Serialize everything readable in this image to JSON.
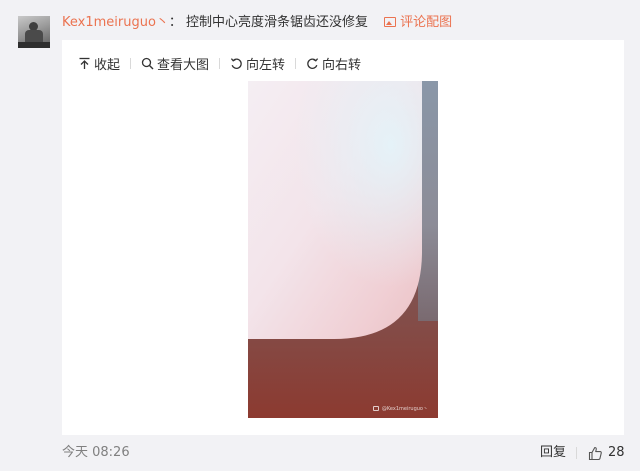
{
  "comment": {
    "username": "Kex1meiruguo丶",
    "separator": "：",
    "text": "控制中心亮度滑条锯齿还没修复",
    "image_link_label": "评论配图"
  },
  "media_toolbar": {
    "collapse_label": "收起",
    "view_large_label": "查看大图",
    "rotate_left_label": "向左转",
    "rotate_right_label": "向右转"
  },
  "photo": {
    "watermark_text": "@Kex1meiruguo丶"
  },
  "footer": {
    "timestamp": "今天 08:26",
    "reply_label": "回复",
    "like_count": "28"
  },
  "colors": {
    "accent": "#eb7350",
    "text": "#333333",
    "muted": "#808080",
    "background": "#f2f2f5"
  },
  "icons": [
    "avatar",
    "image-icon",
    "collapse-icon",
    "search-icon",
    "rotate-left-icon",
    "rotate-right-icon",
    "thumbs-up-icon"
  ]
}
